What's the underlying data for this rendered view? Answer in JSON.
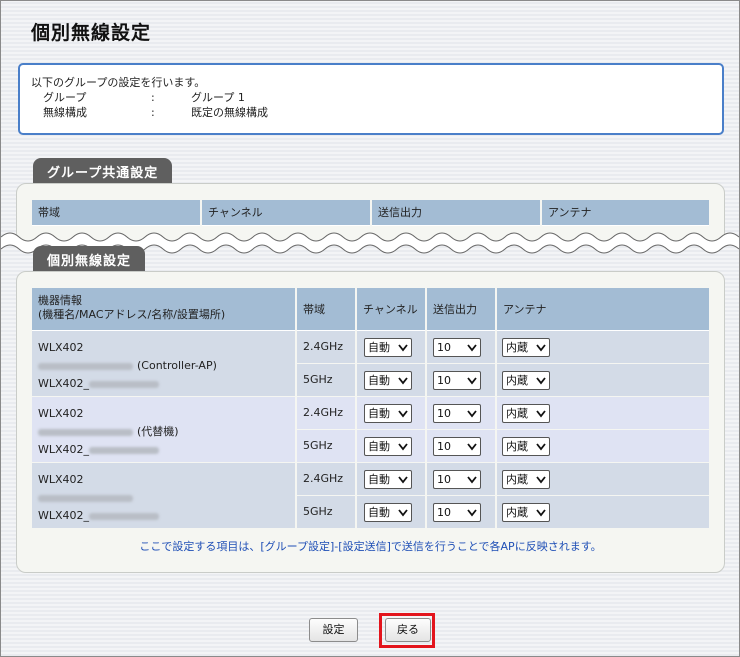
{
  "page": {
    "title": "個別無線設定"
  },
  "info": {
    "intro": "以下のグループの設定を行います。",
    "rows": [
      {
        "key": "グループ",
        "sep": ":",
        "value": "グループ 1"
      },
      {
        "key": "無線構成",
        "sep": ":",
        "value": "既定の無線構成"
      }
    ]
  },
  "common_section": {
    "tab_label": "グループ共通設定",
    "headers": [
      "帯域",
      "チャンネル",
      "送信出力",
      "アンテナ"
    ]
  },
  "individual_section": {
    "tab_label": "個別無線設定",
    "headers": {
      "device_info": "機器情報",
      "device_info_sub": "(機種名/MACアドレス/名称/設置場所)",
      "band": "帯域",
      "channel": "チャンネル",
      "power": "送信出力",
      "antenna": "アンテナ"
    },
    "devices": [
      {
        "model": "WLX402",
        "name_suffix": "(Controller-AP)",
        "location_prefix": "WLX402_",
        "rows": [
          {
            "band": "2.4GHz",
            "channel": "自動",
            "power": "10",
            "antenna": "内蔵"
          },
          {
            "band": "5GHz",
            "channel": "自動",
            "power": "10",
            "antenna": "内蔵"
          }
        ]
      },
      {
        "model": "WLX402",
        "name_suffix": "(代替機)",
        "location_prefix": "WLX402_",
        "rows": [
          {
            "band": "2.4GHz",
            "channel": "自動",
            "power": "10",
            "antenna": "内蔵"
          },
          {
            "band": "5GHz",
            "channel": "自動",
            "power": "10",
            "antenna": "内蔵"
          }
        ]
      },
      {
        "model": "WLX402",
        "name_suffix": "",
        "location_prefix": "WLX402_",
        "rows": [
          {
            "band": "2.4GHz",
            "channel": "自動",
            "power": "10",
            "antenna": "内蔵"
          },
          {
            "band": "5GHz",
            "channel": "自動",
            "power": "10",
            "antenna": "内蔵"
          }
        ]
      }
    ],
    "note": "ここで設定する項目は、[グループ設定]-[設定送信]で送信を行うことで各APに反映されます。"
  },
  "buttons": {
    "set": "設定",
    "back": "戻る"
  },
  "colors": {
    "accent": "#4a7fc9",
    "header": "#a3bcd4",
    "highlight": "#e3141c",
    "note": "#1f4fb6"
  }
}
